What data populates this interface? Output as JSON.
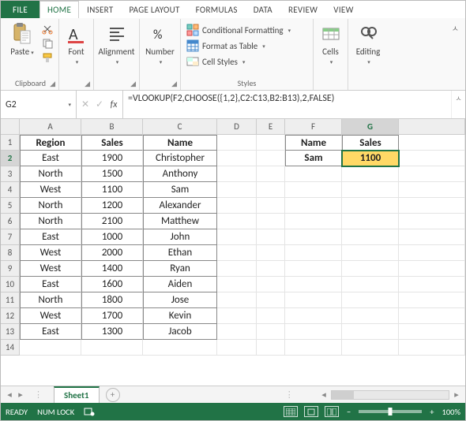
{
  "tabs": {
    "file": "FILE",
    "home": "HOME",
    "insert": "INSERT",
    "pageLayout": "PAGE LAYOUT",
    "formulas": "FORMULAS",
    "data": "DATA",
    "review": "REVIEW",
    "view": "VIEW"
  },
  "ribbon": {
    "clipboard": {
      "paste": "Paste",
      "label": "Clipboard"
    },
    "font": {
      "btn": "Font"
    },
    "alignment": {
      "btn": "Alignment"
    },
    "number": {
      "btn": "Number"
    },
    "styles": {
      "cond": "Conditional Formatting",
      "table": "Format as Table",
      "cell": "Cell Styles",
      "label": "Styles"
    },
    "cells": {
      "btn": "Cells"
    },
    "editing": {
      "btn": "Editing"
    }
  },
  "nameBox": "G2",
  "formula": "=VLOOKUP(F2,CHOOSE({1,2},C2:C13,B2:B13),2,FALSE)",
  "columns": [
    "A",
    "B",
    "C",
    "D",
    "E",
    "F",
    "G"
  ],
  "headers": {
    "A": "Region",
    "B": "Sales",
    "C": "Name"
  },
  "lookup": {
    "nameHdr": "Name",
    "salesHdr": "Sales",
    "name": "Sam",
    "sales": "1100"
  },
  "rows": [
    {
      "r": "1"
    },
    {
      "r": "2",
      "A": "East",
      "B": "1900",
      "C": "Christopher"
    },
    {
      "r": "3",
      "A": "North",
      "B": "1500",
      "C": "Anthony"
    },
    {
      "r": "4",
      "A": "West",
      "B": "1100",
      "C": "Sam"
    },
    {
      "r": "5",
      "A": "North",
      "B": "1200",
      "C": "Alexander"
    },
    {
      "r": "6",
      "A": "North",
      "B": "2100",
      "C": "Matthew"
    },
    {
      "r": "7",
      "A": "East",
      "B": "1000",
      "C": "John"
    },
    {
      "r": "8",
      "A": "West",
      "B": "2000",
      "C": "Ethan"
    },
    {
      "r": "9",
      "A": "West",
      "B": "1400",
      "C": "Ryan"
    },
    {
      "r": "10",
      "A": "East",
      "B": "1600",
      "C": "Aiden"
    },
    {
      "r": "11",
      "A": "North",
      "B": "1800",
      "C": "Jose"
    },
    {
      "r": "12",
      "A": "West",
      "B": "1700",
      "C": "Kevin"
    },
    {
      "r": "13",
      "A": "East",
      "B": "1300",
      "C": "Jacob"
    },
    {
      "r": "14"
    }
  ],
  "sheet": "Sheet1",
  "status": {
    "ready": "READY",
    "numlock": "NUM LOCK",
    "zoom": "100%"
  }
}
